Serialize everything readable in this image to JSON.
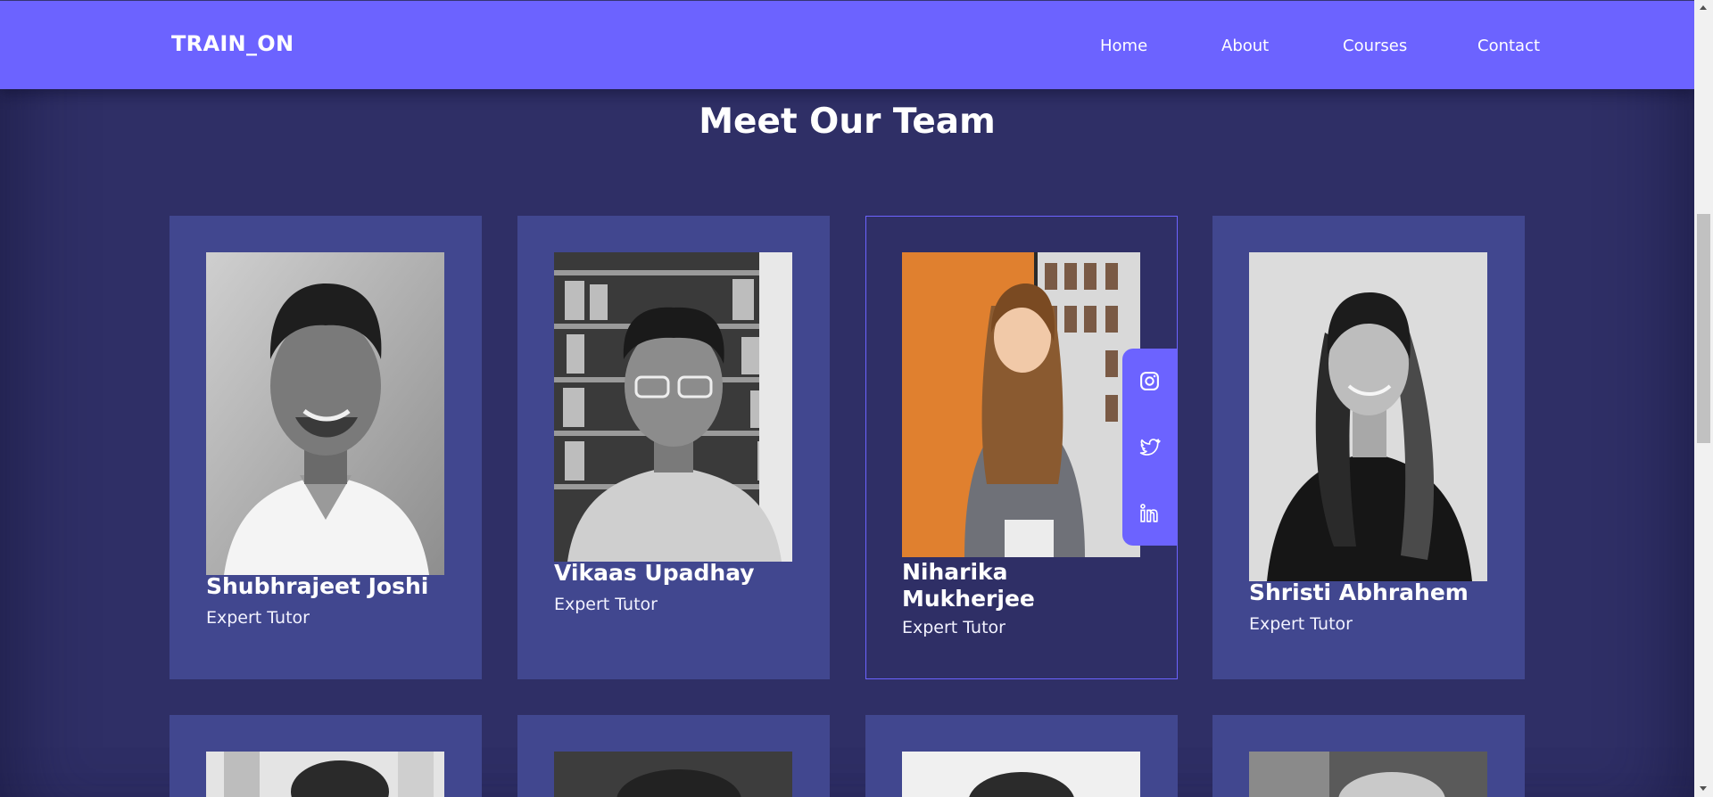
{
  "brand": "TRAIN_ON",
  "nav": [
    {
      "label": "Home"
    },
    {
      "label": "About"
    },
    {
      "label": "Courses"
    },
    {
      "label": "Contact"
    }
  ],
  "section_title": "Meet Our Team",
  "team": [
    {
      "name": "Shubhrajeet Joshi",
      "role": "Expert Tutor"
    },
    {
      "name": "Vikaas Upadhay",
      "role": "Expert Tutor"
    },
    {
      "name": "Niharika Mukherjee",
      "role": "Expert Tutor"
    },
    {
      "name": "Shristi Abhrahem",
      "role": "Expert Tutor"
    }
  ],
  "social_icons": [
    "instagram-icon",
    "twitter-icon",
    "linkedin-icon"
  ],
  "colors": {
    "accent": "#6c63ff",
    "background": "#2f2f66",
    "card": "#41478f"
  }
}
